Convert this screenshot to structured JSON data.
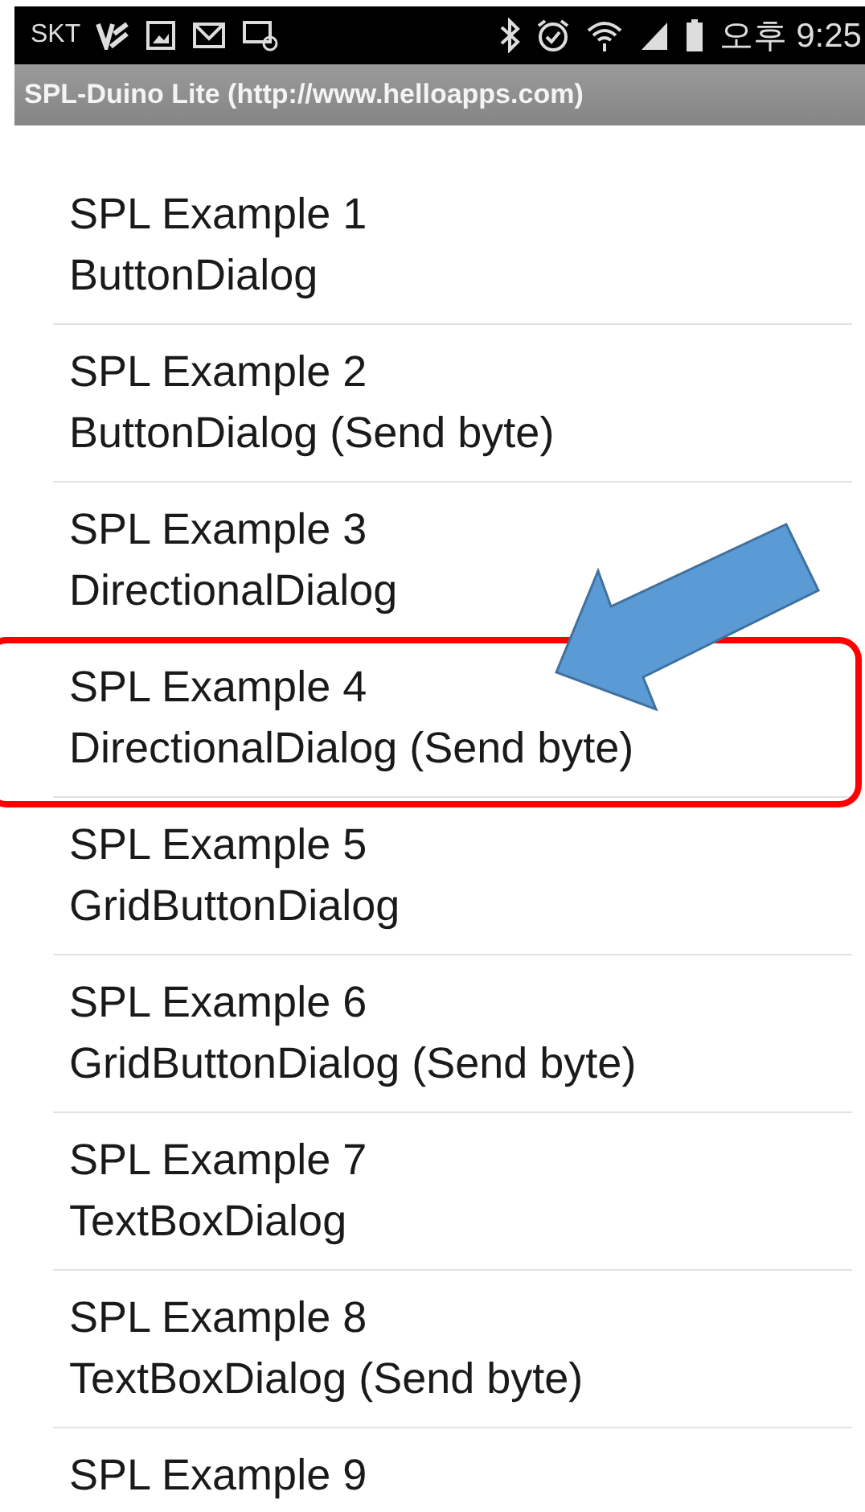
{
  "status_bar": {
    "carrier": "SKT",
    "time": "오후 9:25"
  },
  "app_bar": {
    "title": "SPL-Duino Lite (http://www.helloapps.com)"
  },
  "examples": [
    {
      "title": "SPL Example 1",
      "subtitle": "ButtonDialog",
      "highlighted": false
    },
    {
      "title": "SPL Example 2",
      "subtitle": "ButtonDialog (Send byte)",
      "highlighted": false
    },
    {
      "title": "SPL Example 3",
      "subtitle": "DirectionalDialog",
      "highlighted": false
    },
    {
      "title": "SPL Example 4",
      "subtitle": "DirectionalDialog (Send byte)",
      "highlighted": true
    },
    {
      "title": "SPL Example 5",
      "subtitle": "GridButtonDialog",
      "highlighted": false
    },
    {
      "title": "SPL Example 6",
      "subtitle": "GridButtonDialog (Send byte)",
      "highlighted": false
    },
    {
      "title": "SPL Example 7",
      "subtitle": "TextBoxDialog",
      "highlighted": false
    },
    {
      "title": "SPL Example 8",
      "subtitle": "TextBoxDialog (Send byte)",
      "highlighted": false
    },
    {
      "title": "SPL Example 9",
      "highlighted": false
    }
  ]
}
